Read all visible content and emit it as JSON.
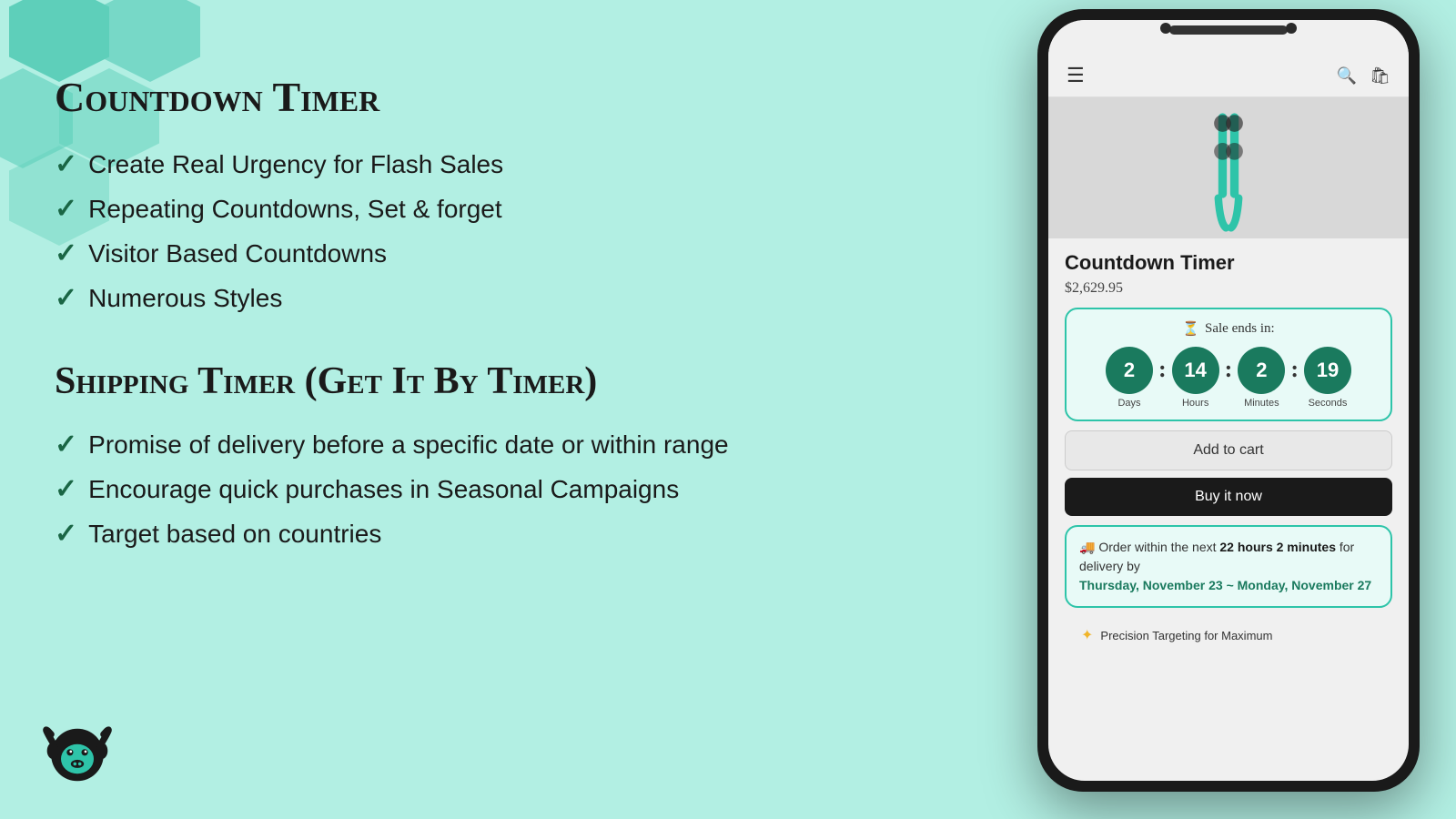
{
  "background_color": "#b2efe3",
  "hex_color": "#5ecfba",
  "left": {
    "section1_title": "Countdown Timer",
    "features1": [
      "Create Real Urgency for Flash Sales",
      "Repeating Countdowns, Set & forget",
      "Visitor Based Countdowns",
      "Numerous Styles"
    ],
    "section2_title": "Shipping Timer (Get It By Timer)",
    "features2": [
      "Promise of delivery before a specific date or within range",
      "Encourage quick purchases in Seasonal Campaigns",
      "Target based on countries"
    ]
  },
  "phone": {
    "product_title": "Countdown Timer",
    "product_price": "$2,629.95",
    "countdown": {
      "header": "Sale ends in:",
      "hourglass": "⏳",
      "days_value": "2",
      "days_label": "Days",
      "hours_value": "14",
      "hours_label": "Hours",
      "minutes_value": "2",
      "minutes_label": "Minutes",
      "seconds_value": "19",
      "seconds_label": "Seconds"
    },
    "btn_add_cart": "Add to cart",
    "btn_buy_now": "Buy it now",
    "shipping": {
      "truck": "🚚",
      "text_before": "Order within the next",
      "bold_time": "22 hours 2 minutes",
      "text_middle": " for delivery by",
      "green_date": "Thursday, November 23 ~ Monday, November 27"
    },
    "precision_star": "✦",
    "precision_text": "Precision Targeting for Maximum"
  }
}
